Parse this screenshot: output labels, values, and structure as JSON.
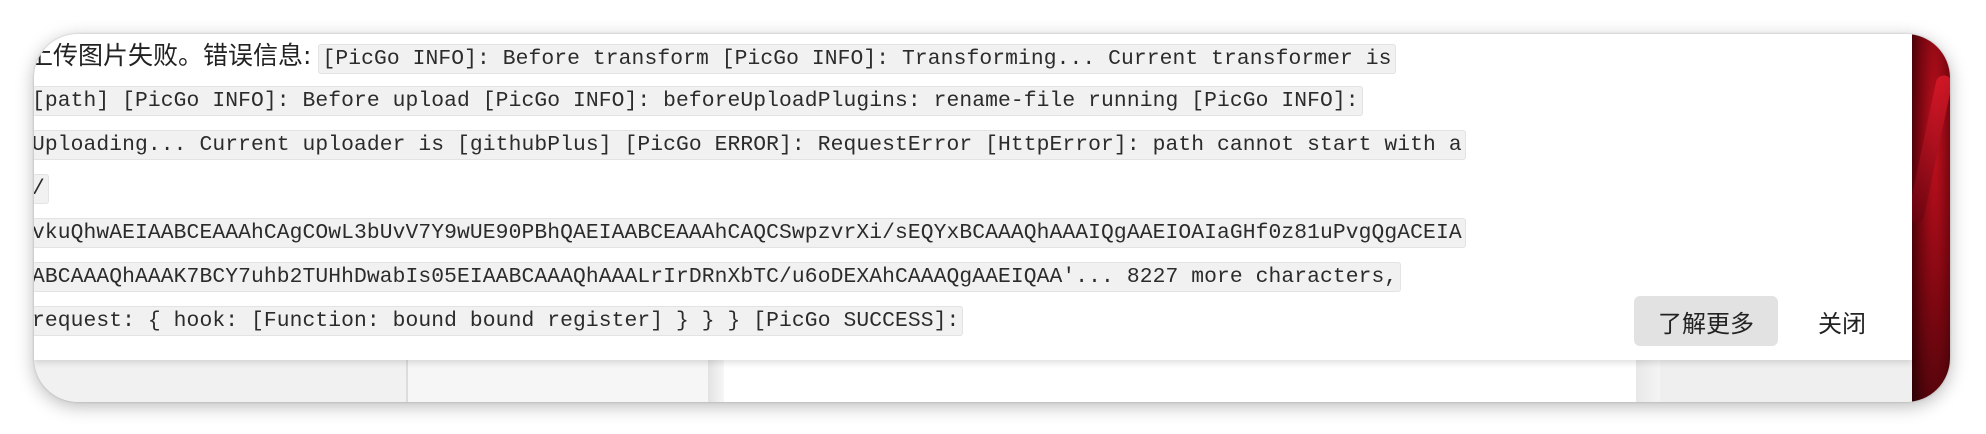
{
  "toast": {
    "prefix": "上传图片失败。错误信息:",
    "log_lines": [
      "[PicGo INFO]: Before transform [PicGo INFO]: Transforming... Current transformer is",
      "[path] [PicGo INFO]: Before upload [PicGo INFO]: beforeUploadPlugins: rename-file running [PicGo INFO]:",
      "Uploading... Current uploader is [githubPlus] [PicGo ERROR]: RequestError [HttpError]: path cannot start with a",
      "/",
      "vkuQhwAEIAABCEAAAhCAgCOwL3bUvV7Y9wUE90PBhQAEIAABCEAAAhCAQCSwpzvrXi/sEQYxBCAAAQhAAAIQgAAEIOAIaGHf0z81uPvgQgACEIA",
      "ABCAAAQhAAAK7BCY7uhb2TUHhDwabIs05EIAABCAAAQhAAALrIrDRnXbTC/u6oDEXAhCAAAQgAAEIQAA'... 8227 more characters,",
      "request: { hook: [Function: bound bound register] } } } [PicGo SUCCESS]:"
    ],
    "learn_more_label": "了解更多",
    "close_label": "关闭"
  },
  "colors": {
    "code_background": "#f1f1f1",
    "button_background": "#e2e2e2",
    "wallpaper_accent": "#c0101d"
  }
}
